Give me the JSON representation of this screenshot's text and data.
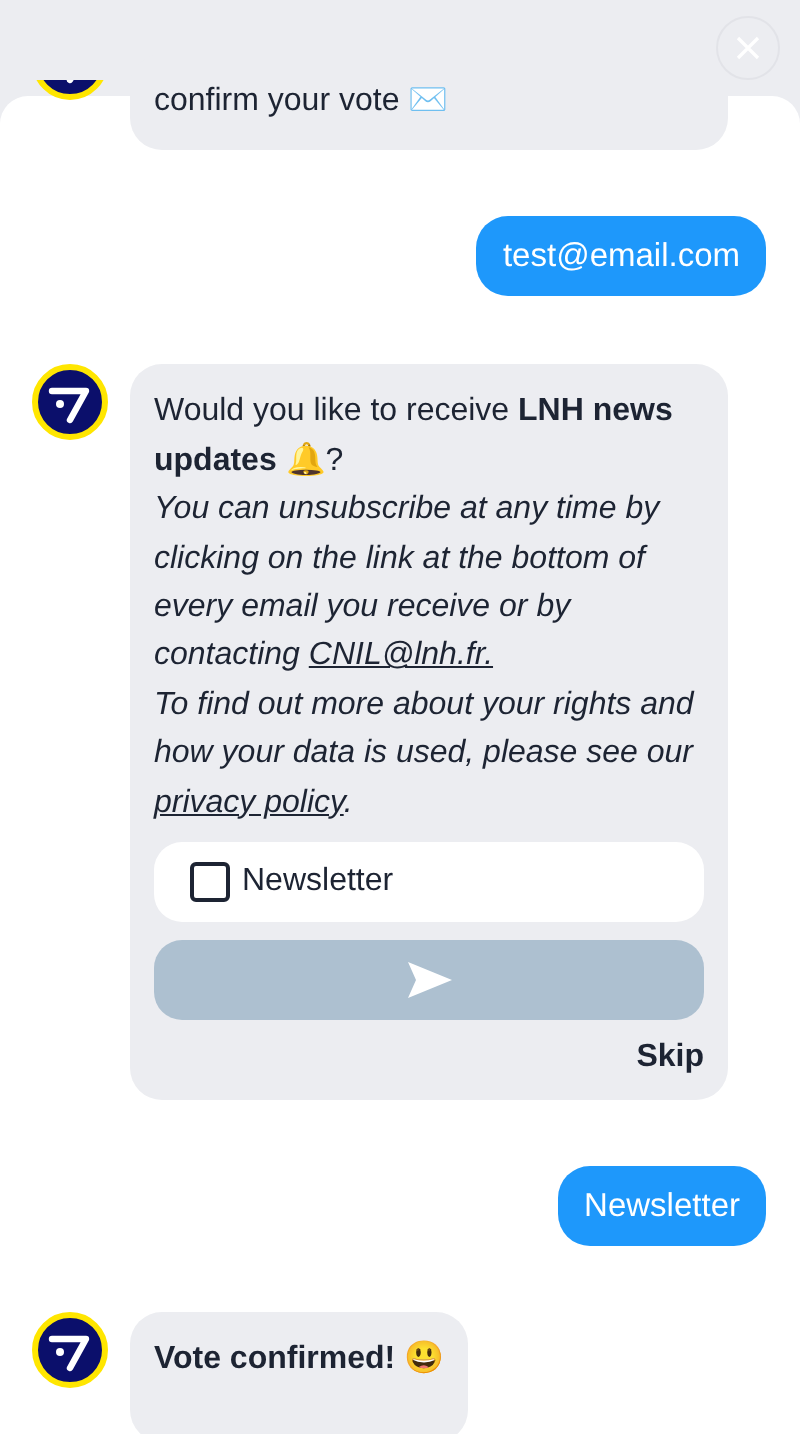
{
  "messages": [
    {
      "kind": "bot_text",
      "avatar": true,
      "text": "confirm your vote ✉️"
    },
    {
      "kind": "user_text",
      "text": "test@email.com"
    },
    {
      "kind": "bot_form",
      "avatar": true,
      "question": "Would you like to receive **LNH news updates** 🔔?",
      "note": [
        {
          "kind": "text",
          "text": "You can unsubscribe at any time by clicking on the link at the bottom of every email you receive or by contacting "
        },
        {
          "kind": "link",
          "text": "CNIL@lnh.fr."
        },
        {
          "kind": "break"
        },
        {
          "kind": "text",
          "text": "To find out more about your rights and how your data is used, please see our "
        },
        {
          "kind": "link",
          "text": "privacy policy"
        },
        {
          "kind": "text",
          "text": "."
        }
      ],
      "options": [
        {
          "label": "Newsletter",
          "checked": false
        }
      ],
      "submit": {
        "disabled": true
      },
      "skip": "Skip"
    },
    {
      "kind": "user_text",
      "text": "Newsletter"
    },
    {
      "kind": "bot_text",
      "avatar": true,
      "bold": true,
      "text": "Vote confirmed! 😃"
    }
  ]
}
